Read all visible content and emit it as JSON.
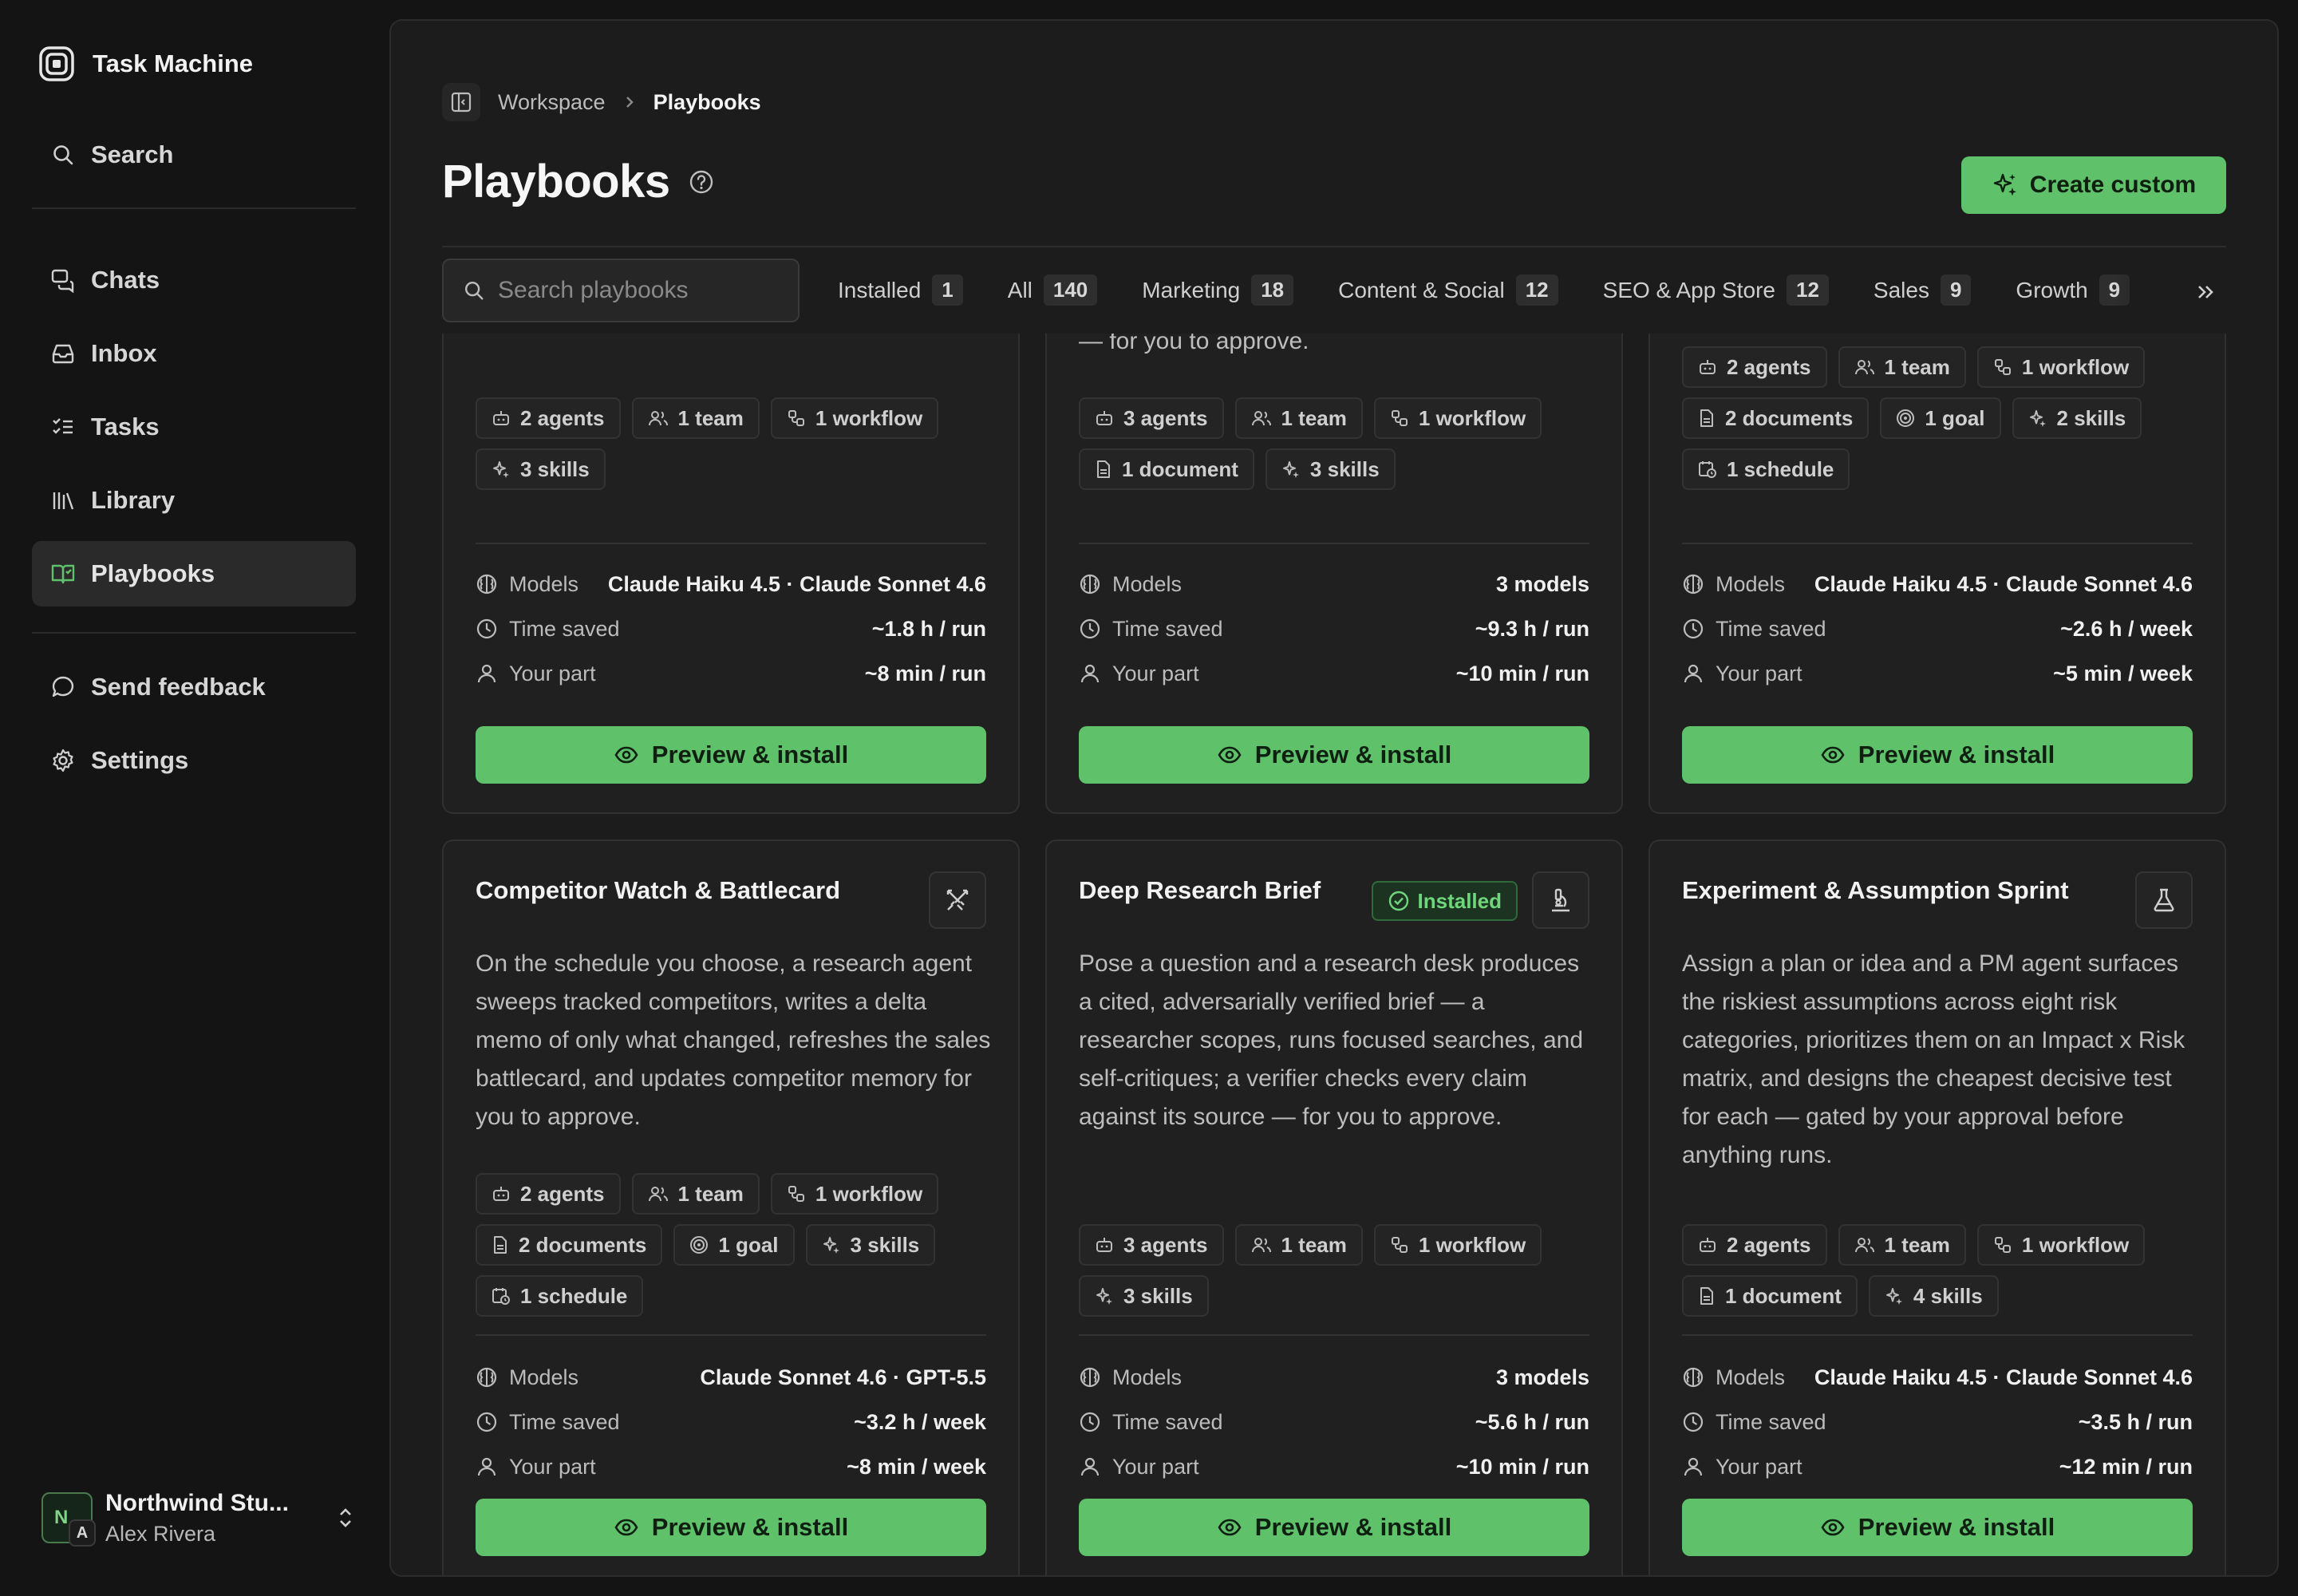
{
  "app": {
    "name": "Task Machine"
  },
  "sidebar": {
    "search": "Search",
    "items": [
      {
        "label": "Chats",
        "icon": "chats-icon"
      },
      {
        "label": "Inbox",
        "icon": "inbox-icon"
      },
      {
        "label": "Tasks",
        "icon": "tasks-icon"
      },
      {
        "label": "Library",
        "icon": "library-icon"
      },
      {
        "label": "Playbooks",
        "icon": "playbooks-icon",
        "active": true
      }
    ],
    "bottom_items": [
      {
        "label": "Send feedback",
        "icon": "feedback-icon"
      },
      {
        "label": "Settings",
        "icon": "settings-icon"
      }
    ],
    "org": {
      "name": "Northwind Stu...",
      "user": "Alex Rivera",
      "initial_org": "N",
      "initial_user": "A"
    }
  },
  "breadcrumb": {
    "parent": "Workspace",
    "current": "Playbooks"
  },
  "page": {
    "title": "Playbooks",
    "create_label": "Create custom"
  },
  "search": {
    "placeholder": "Search playbooks"
  },
  "filters": [
    {
      "label": "Installed",
      "count": "1"
    },
    {
      "label": "All",
      "count": "140"
    },
    {
      "label": "Marketing",
      "count": "18"
    },
    {
      "label": "Content & Social",
      "count": "12"
    },
    {
      "label": "SEO & App Store",
      "count": "12"
    },
    {
      "label": "Sales",
      "count": "9"
    },
    {
      "label": "Growth",
      "count": "9"
    }
  ],
  "stat_labels": {
    "models": "Models",
    "time_saved": "Time saved",
    "your_part": "Your part"
  },
  "preview_label": "Preview & install",
  "installed_label": "Installed",
  "top_cards": [
    {
      "desc_tail": "",
      "chips": [
        "2 agents",
        "1 team",
        "1 workflow",
        "3 skills"
      ],
      "models": "Claude Haiku 4.5 · Claude Sonnet 4.6",
      "time_saved": "~1.8 h / run",
      "your_part": "~8 min / run"
    },
    {
      "desc_tail": "— for you to approve.",
      "chips": [
        "3 agents",
        "1 team",
        "1 workflow",
        "1 document",
        "3 skills"
      ],
      "models": "3 models",
      "time_saved": "~9.3 h / run",
      "your_part": "~10 min / run"
    },
    {
      "desc_tail": "",
      "chips": [
        "2 agents",
        "1 team",
        "1 workflow",
        "2 documents",
        "1 goal",
        "2 skills",
        "1 schedule"
      ],
      "models": "Claude Haiku 4.5 · Claude Sonnet 4.6",
      "time_saved": "~2.6 h / week",
      "your_part": "~5 min / week"
    }
  ],
  "cards": [
    {
      "title": "Competitor Watch & Battlecard",
      "icon": "swords-icon",
      "installed": false,
      "description": "On the schedule you choose, a research agent sweeps tracked competitors, writes a delta memo of only what changed, refreshes the sales battlecard, and updates competitor memory for you to approve.",
      "chips": [
        "2 agents",
        "1 team",
        "1 workflow",
        "2 documents",
        "1 goal",
        "3 skills",
        "1 schedule"
      ],
      "models": "Claude Sonnet 4.6 · GPT-5.5",
      "time_saved": "~3.2 h / week",
      "your_part": "~8 min / week"
    },
    {
      "title": "Deep Research Brief",
      "icon": "microscope-icon",
      "installed": true,
      "description": "Pose a question and a research desk produces a cited, adversarially verified brief — a researcher scopes, runs focused searches, and self-critiques; a verifier checks every claim against its source — for you to approve.",
      "chips": [
        "3 agents",
        "1 team",
        "1 workflow",
        "3 skills"
      ],
      "models": "3 models",
      "time_saved": "~5.6 h / run",
      "your_part": "~10 min / run"
    },
    {
      "title": "Experiment & Assumption Sprint",
      "icon": "flask-icon",
      "installed": false,
      "description": "Assign a plan or idea and a PM agent surfaces the riskiest assumptions across eight risk categories, prioritizes them on an Impact x Risk matrix, and designs the cheapest decisive test for each — gated by your approval before anything runs.",
      "chips": [
        "2 agents",
        "1 team",
        "1 workflow",
        "1 document",
        "4 skills"
      ],
      "models": "Claude Haiku 4.5 · Claude Sonnet 4.6",
      "time_saved": "~3.5 h / run",
      "your_part": "~12 min / run"
    }
  ],
  "colors": {
    "accent": "#5fc26b",
    "background": "#141414",
    "panel": "#1c1c1c"
  }
}
